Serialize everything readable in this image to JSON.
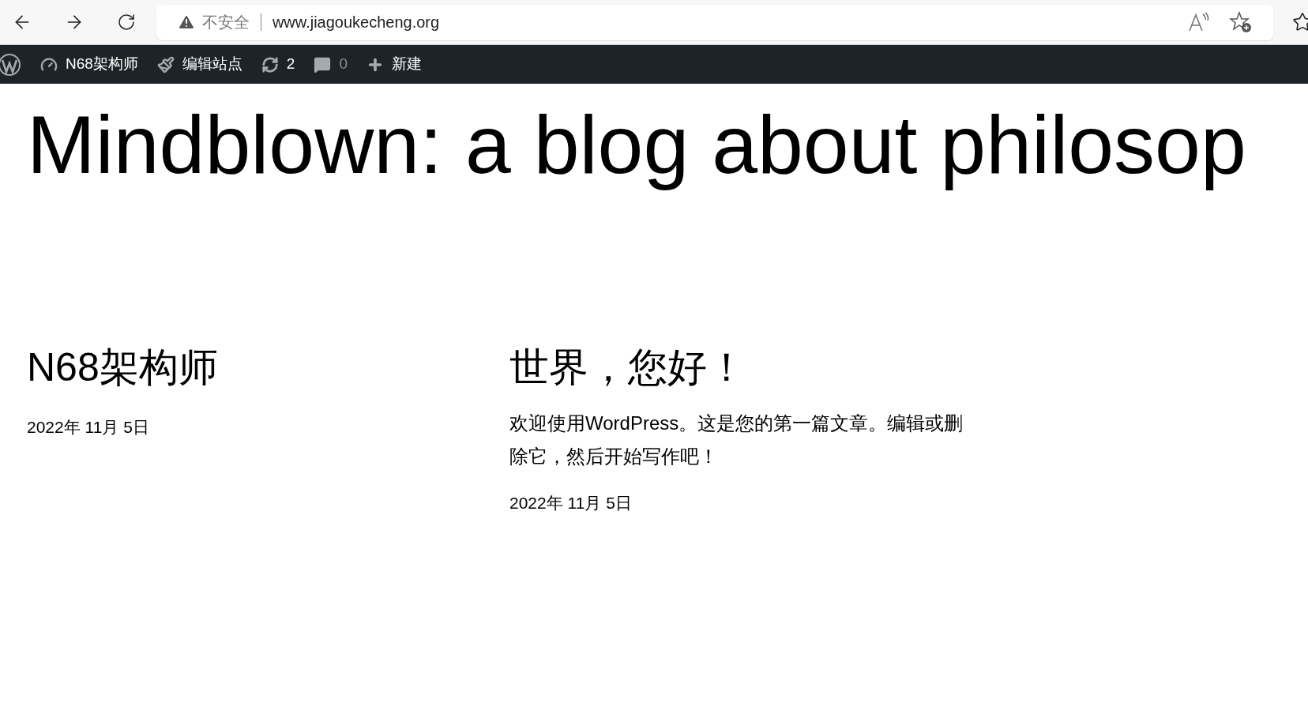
{
  "browser": {
    "security_label": "不安全",
    "url": "www.jiagoukecheng.org"
  },
  "admin_bar": {
    "items": [
      {
        "kind": "site",
        "label": "N68架构师"
      },
      {
        "kind": "edit",
        "label": "编辑站点"
      },
      {
        "kind": "updates",
        "label": "2"
      },
      {
        "kind": "comments",
        "label": "0"
      },
      {
        "kind": "new",
        "label": "新建"
      }
    ]
  },
  "site_title": "Mindblown: a blog about philosop",
  "posts": [
    {
      "title": "N68架构师",
      "date": "2022年 11月 5日"
    },
    {
      "title": "世界，您好！",
      "excerpt": "欢迎使用WordPress。这是您的第一篇文章。编辑或删除它，然后开始写作吧！",
      "date": "2022年 11月 5日"
    }
  ]
}
